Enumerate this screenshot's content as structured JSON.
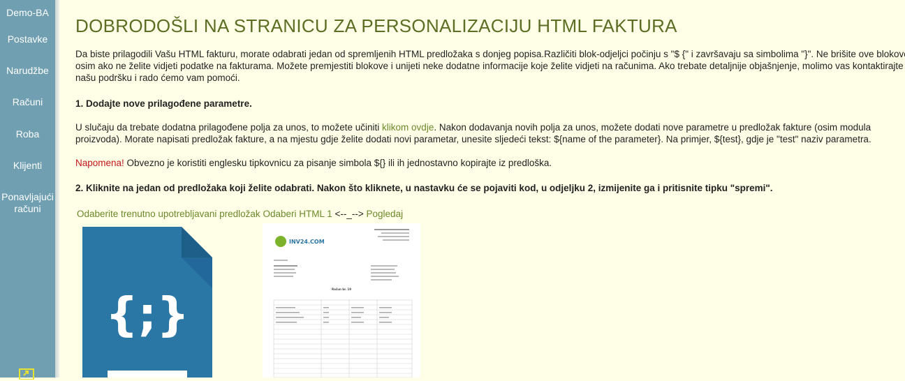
{
  "sidebar": {
    "items": [
      {
        "label": "Demo-BA"
      },
      {
        "label": "Postavke"
      },
      {
        "label": "Narudžbe"
      },
      {
        "label": "Računi"
      },
      {
        "label": "Roba"
      },
      {
        "label": "Klijenti"
      },
      {
        "label_line1": "Ponavljajući",
        "label_line2": "računi"
      }
    ]
  },
  "main": {
    "title": "DOBRODOŠLI NA STRANICU ZA PERSONALIZACIJU HTML FAKTURA",
    "intro": [
      "Da biste prilagodili Vašu HTML fakturu, morate odabrati jedan od spremljenih HTML predložaka s donjeg popisa.Različiti blok-odjeljci počinju s \"$ {\" i završavaju sa simbolima \"}\". Ne brišite ove blokove",
      "osim ako ne želite vidjeti podatke na fakturama. Možete premjestiti blokove i unijeti neke dodatne informacije koje želite vidjeti na računima. Ako trebate detaljnije objašnjenje, molimo vas kontaktirajte",
      "našu podršku i rado ćemo vam pomoći."
    ],
    "step1_heading": "1. Dodajte nove prilagođene parametre.",
    "step1_text": {
      "before_link": "U slučaju da trebate dodatna prilagođene polja za unos, to možete učiniti ",
      "link": "klikom ovdje",
      "after_link": ". Nakon dodavanja novih polja za unos, možete dodati nove parametre u predložak fakture (osim modula",
      "line2": "proizvoda). Morate napisati predložak fakture, a na mjestu gdje želite dodati novi parametar, unesite sljedeći tekst: ${name of the parameter}. Na primjer, ${test}, gdje je \"test\" naziv parametra."
    },
    "note": {
      "label": "Napomena!",
      "text": " Obvezno je koristiti englesku tipkovnicu za pisanje simbola ${} ili ih jednostavno kopirajte iz predloška."
    },
    "step2_heading": "2. Kliknite na jedan od predložaka koji želite odabrati. Nakon što kliknete, u nastavku će se pojaviti kod, u odjeljku 2, izmijenite ga i pritisnite tipku \"spremi\".",
    "template_links": {
      "current": "Odaberite trenutno upotrebljavani predložak",
      "choose": "Odaberi HTML 1",
      "separator": "<--_-->",
      "preview": "Pogledaj"
    },
    "preview_logo_text": "INV24.COM",
    "preview_title": "Račun br. 19"
  },
  "colors": {
    "sidebar_bg": "#6f9fb0",
    "page_bg": "#fffee6",
    "title": "#5b6e23",
    "link": "#6b8a2a",
    "note": "#c4161c",
    "icon_blue": "#2a77a6"
  },
  "icons": [
    "html-file-icon",
    "invoice-preview-thumbnail",
    "upload-icon"
  ]
}
